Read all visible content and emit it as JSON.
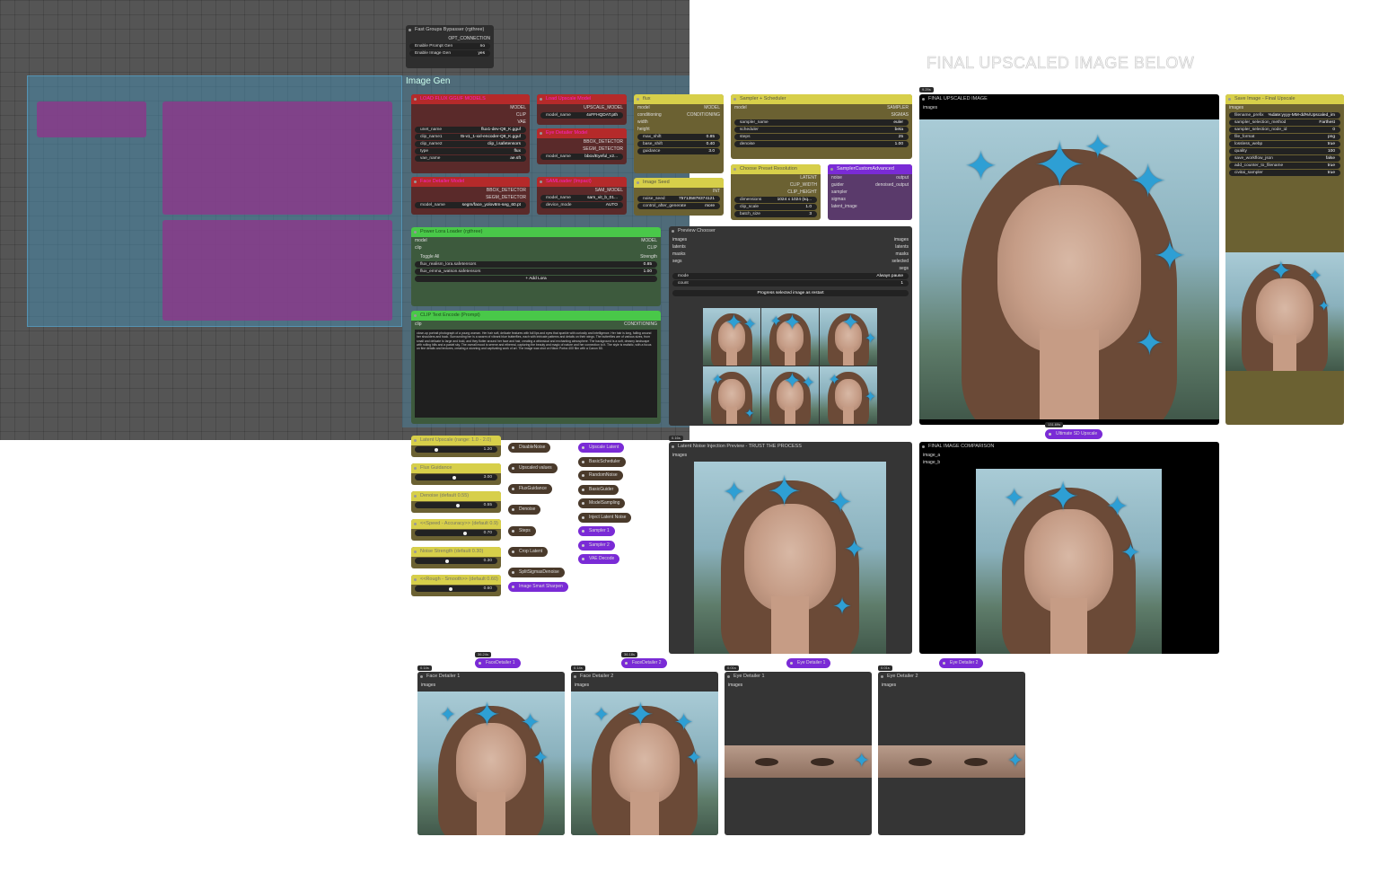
{
  "banner": {
    "title": "FINAL UPSCALED IMAGE BELOW"
  },
  "bypasser": {
    "title": "Fast Groups Bypasser (rgthree)",
    "output": "OPT_CONNECTION",
    "rows": [
      {
        "label": "Enable Prompt Gen",
        "value": "no"
      },
      {
        "label": "Enable Image Gen",
        "value": "yes"
      }
    ]
  },
  "groups": {
    "image_gen": "Image Gen"
  },
  "loader": {
    "title": "LOAD FLUX GGUF MODELS",
    "outputs": [
      "MODEL",
      "CLIP",
      "VAE"
    ],
    "widgets": [
      {
        "label": "unet_name",
        "value": "flux1-dev-Q8_K.gguf"
      },
      {
        "label": "clip_name1",
        "value": "t5-v1_1-xxl-encoder-Q8_K.gguf"
      },
      {
        "label": "clip_name2",
        "value": "clip_l.safetensors"
      },
      {
        "label": "type",
        "value": "flux"
      },
      {
        "label": "vae_name",
        "value": "ae.sft"
      }
    ]
  },
  "upscale_model": {
    "title": "Load Upscale Model",
    "output": "UPSCALE_MODEL",
    "widget": {
      "label": "model_name",
      "value": "4xFFHQDAT.pth"
    }
  },
  "eye_detailer": {
    "title": "Eye Detailer Model",
    "outputs": [
      "BBOX_DETECTOR",
      "SEGM_DETECTOR"
    ],
    "widget": {
      "label": "model_name",
      "value": "bbox/Eyeful_v2..."
    }
  },
  "face_detailer_model": {
    "title": "Face Detailer Model",
    "outputs": [
      "BBOX_DETECTOR",
      "SEGM_DETECTOR"
    ],
    "widget": {
      "label": "model_name",
      "value": "segm/face_yolov8m-seg_60.pt"
    }
  },
  "sam_loader": {
    "title": "SAMLoader (Impact)",
    "output": "SAM_MODEL",
    "widgets": [
      {
        "label": "model_name",
        "value": "sam_vit_b_01..."
      },
      {
        "label": "device_mode",
        "value": "AUTO"
      }
    ]
  },
  "flux_node": {
    "title": "flux",
    "inputs": [
      "model",
      "conditioning",
      "width",
      "height"
    ],
    "outputs": [
      "MODEL",
      "CONDITIONING"
    ],
    "widgets": [
      {
        "label": "max_shift",
        "value": "0.85"
      },
      {
        "label": "base_shift",
        "value": "0.40"
      },
      {
        "label": "guidance",
        "value": "3.0"
      }
    ]
  },
  "image_seed": {
    "title": "Image Seed",
    "output": "INT",
    "widgets": [
      {
        "label": "noise_seed",
        "value": "757135878374121"
      },
      {
        "label": "control_after_generate",
        "value": "more"
      }
    ]
  },
  "sampler": {
    "title": "Sampler + Scheduler",
    "input": "model",
    "outputs": [
      "SAMPLER",
      "SIGMAS"
    ],
    "widgets": [
      {
        "label": "sampler_name",
        "value": "euler"
      },
      {
        "label": "scheduler",
        "value": "beta"
      },
      {
        "label": "steps",
        "value": "25"
      },
      {
        "label": "denoise",
        "value": "1.00"
      }
    ]
  },
  "choose_res": {
    "title": "Choose Preset Resolution",
    "outputs": [
      "LATENT",
      "CLIP_WIDTH",
      "CLIP_HEIGHT"
    ],
    "widgets": [
      {
        "label": "dimensions",
        "value": "1024 x 1024 (sq..."
      },
      {
        "label": "clip_scale",
        "value": "1.0"
      },
      {
        "label": "batch_size",
        "value": "3"
      }
    ]
  },
  "custom_adv": {
    "title": "SamplerCustomAdvanced",
    "inputs": [
      "noise",
      "guider",
      "sampler",
      "sigmas",
      "latent_image"
    ],
    "outputs": [
      "output",
      "denoised_output"
    ]
  },
  "lora": {
    "title": "Power Lora Loader (rgthree)",
    "inputs": [
      "model",
      "clip"
    ],
    "outputs": [
      "MODEL",
      "CLIP"
    ],
    "toggle": "Toggle All",
    "strength": "Strength",
    "items": [
      {
        "name": "flux_realism_lora.safetensors",
        "value": "0.85"
      },
      {
        "name": "flux_emma_watson.safetensors",
        "value": "1.00"
      }
    ],
    "add": "+ Add Lora"
  },
  "clip_text": {
    "title": "CLIP Text Encode (Prompt)",
    "input": "clip",
    "output": "CONDITIONING",
    "prompt": "close-up portrait photograph of a young woman. Her hair soft, delicate features with full lips and eyes that sparkle with curiosity and intelligence. Her hair is long, falling around her shoulders and back. Surrounding her is a swarm of vibrant blue butterflies, each with intricate patterns and details on their wings. The butterflies are of various sizes, from small and delicate to large and bold, and they flutter around her face and hair, creating a whimsical and enchanting atmosphere. The background is a soft, dreamy landscape with rolling hills and a pastel sky. The overall mood is serene and ethereal, capturing the beauty and magic of nature and her connection to it. The style is realistic, with a focus on fine details and textures, creating a stunning and captivating work of art. The image was shot on Nikon Portra 400 film with a Canon 5D."
  },
  "preview_chooser": {
    "title": "Preview Chooser",
    "inputs": [
      "images",
      "latents",
      "masks",
      "segs"
    ],
    "outputs": [
      "images",
      "latents",
      "masks",
      "selected",
      "segs"
    ],
    "widgets": [
      {
        "label": "mode",
        "value": "Always pause"
      },
      {
        "label": "count",
        "value": "1"
      }
    ],
    "button": "Progress selected image as restart"
  },
  "final_upscaled": {
    "title": "FINAL UPSCALED IMAGE",
    "input": "images",
    "badge": "9.29s"
  },
  "save_image": {
    "title": "Save Image - Final Upscale",
    "input": "images",
    "widgets": [
      {
        "label": "filename_prefix",
        "value": "%date:yyyy-MM-dd%/Upscaled_im"
      },
      {
        "label": "sampler_selection_method",
        "value": "Farthest"
      },
      {
        "label": "sampler_selection_node_id",
        "value": "0"
      },
      {
        "label": "file_format",
        "value": "png"
      },
      {
        "label": "lossless_webp",
        "value": "true"
      },
      {
        "label": "quality",
        "value": "100"
      },
      {
        "label": "save_workflow_json",
        "value": "false"
      },
      {
        "label": "add_counter_to_filename",
        "value": "true"
      },
      {
        "label": "civitai_sampler",
        "value": "true"
      }
    ]
  },
  "sliders": [
    {
      "title": "Latent Upscale (range: 1.0 - 2.0)",
      "value": "1.20",
      "frac": 0.2
    },
    {
      "title": "Flux Guidance",
      "value": "3.00",
      "frac": 0.45
    },
    {
      "title": "Denoise (default 0.55)",
      "value": "0.55",
      "frac": 0.5
    },
    {
      "title": "<<Speed - Accuracy>> (default 0.9)",
      "value": "0.70",
      "frac": 0.6
    },
    {
      "title": "Noise Strength (default 0.30)",
      "value": "0.30",
      "frac": 0.35
    },
    {
      "title": "<<Rough - Smooth>> (default 0.60)",
      "value": "0.60",
      "frac": 0.4
    }
  ],
  "mini_brown": [
    "DisableNoise",
    "Upscaled values",
    "FluxGuidance",
    "Denoise",
    "Steps",
    "Crop Latent",
    "SplitSigmasDenoise"
  ],
  "mini_purple": [
    "Image Smart Sharpen"
  ],
  "mid_nodes": [
    {
      "label": "Upscale Latent",
      "c": "#7a2bd6"
    },
    {
      "label": "BasicScheduler",
      "c": "#4a3a2b"
    },
    {
      "label": "RandomNoise",
      "c": "#4a3a2b"
    },
    {
      "label": "BasicGuider",
      "c": "#4a3a2b"
    },
    {
      "label": "ModelSampling",
      "c": "#4a3a2b"
    },
    {
      "label": "Inject Latent Noise",
      "c": "#4a3a2b"
    },
    {
      "label": "Sampler 1",
      "c": "#7a2bd6"
    },
    {
      "label": "Sampler 2",
      "c": "#7a2bd6"
    },
    {
      "label": "VAE Decode",
      "c": "#7a2bd6"
    }
  ],
  "ultimate": {
    "label": "Ultimate SD Upscale",
    "badge": "131.69s"
  },
  "latent_preview": {
    "title": "Latent Noise Injection Preview - TRUST THE PROCESS",
    "input": "images",
    "badge": "0.16s"
  },
  "comparison": {
    "title": "FINAL IMAGE COMPARISON",
    "inputs": [
      "image_a",
      "image_b"
    ]
  },
  "detailer_tags": [
    {
      "label": "FaceDetailer 1",
      "badge": "36.24s"
    },
    {
      "label": "FaceDetailer 2",
      "badge": "36.18s"
    },
    {
      "label": "Eye Detailer 1",
      "badge": ""
    },
    {
      "label": "Eye Detailer 2",
      "badge": ""
    }
  ],
  "detailer_previews": [
    {
      "title": "Face Detailer 1",
      "input": "images",
      "badge": "0.14s"
    },
    {
      "title": "Face Detailer 2",
      "input": "images",
      "badge": "0.14s"
    },
    {
      "title": "Eye Detailer 1",
      "input": "images",
      "badge": "0.01s"
    },
    {
      "title": "Eye Detailer 2",
      "input": "images",
      "badge": "0.01s"
    }
  ],
  "colors": {
    "red": "#b52a2a",
    "yellow": "#d7cf4a",
    "green": "#49c849",
    "purple": "#7a2bd6",
    "group_teal": "#3f8fae",
    "group_magenta": "#a03fa0"
  }
}
